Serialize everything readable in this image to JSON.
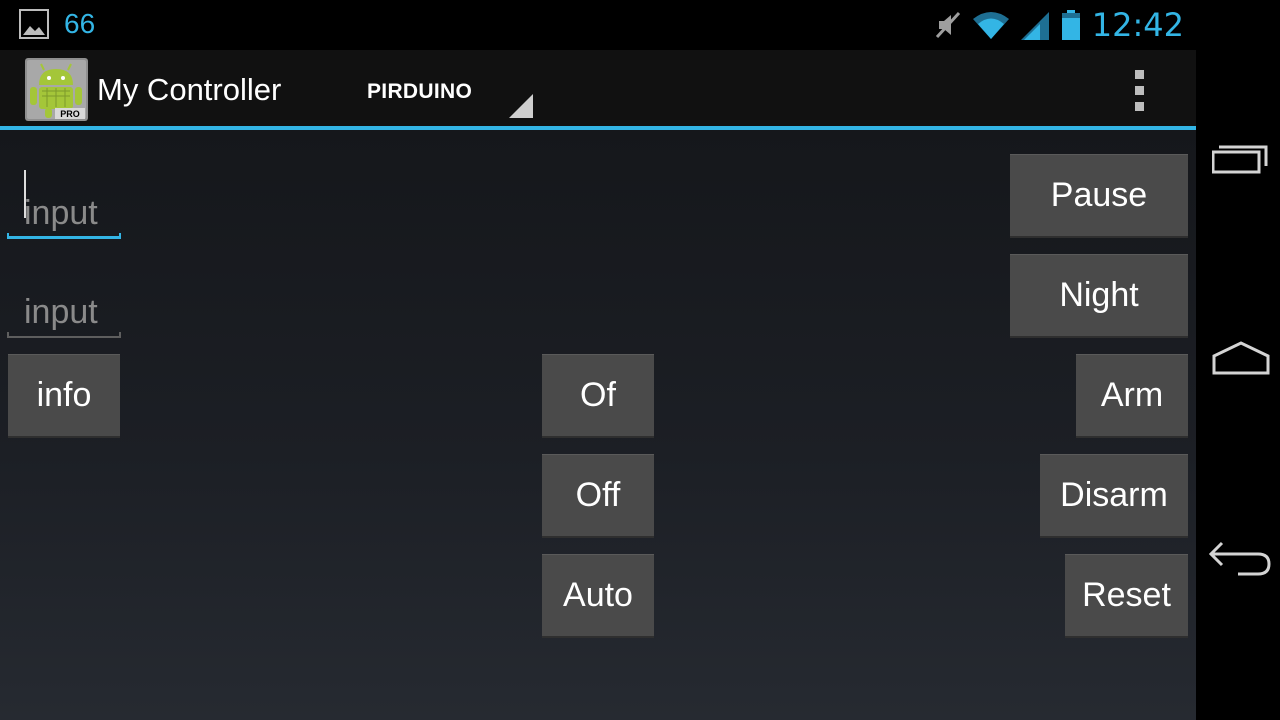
{
  "status_bar": {
    "notification_icon": "image-icon",
    "notification_count": "66",
    "icons": [
      "mute-icon",
      "wifi-icon",
      "signal-icon",
      "battery-icon"
    ],
    "time": "12:42"
  },
  "action_bar": {
    "app_icon": "android-robot-pro-icon",
    "title": "My Controller",
    "spinner_value": "PIRDUINO",
    "overflow_icon": "overflow-menu-icon"
  },
  "inputs": [
    {
      "placeholder": "input",
      "value": "",
      "focused": true
    },
    {
      "placeholder": "input",
      "value": "",
      "focused": false
    }
  ],
  "buttons": {
    "pause": "Pause",
    "night": "Night",
    "info": "info",
    "of": "Of",
    "arm": "Arm",
    "off": "Off",
    "disarm": "Disarm",
    "auto": "Auto",
    "reset": "Reset"
  },
  "nav_bar": {
    "icons": [
      "recent-apps-icon",
      "home-icon",
      "back-icon"
    ]
  },
  "colors": {
    "accent": "#33b5e5",
    "button": "#4a4a4a",
    "action_bar": "#111111"
  }
}
